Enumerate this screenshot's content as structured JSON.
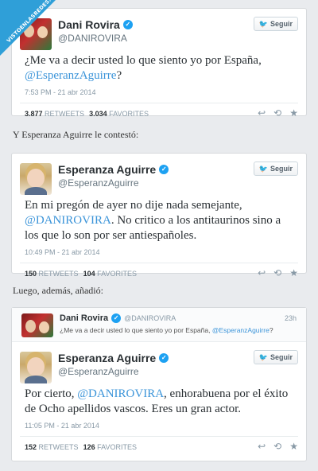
{
  "watermark": "VISTOENLASREDES.com",
  "tweet1": {
    "name": "Dani Rovira",
    "handle": "@DANIROVIRA",
    "follow": "Seguir",
    "text_a": "¿Me va a decir usted lo que siento yo por España,",
    "mention": "@EsperanzAguirre",
    "text_b": "?",
    "time": "7:53 PM - 21 abr 2014",
    "retweets": "3.877",
    "retweets_label": "RETWEETS",
    "favorites": "3.034",
    "favorites_label": "FAVORITES"
  },
  "caption1": "Y Esperanza Aguirre le contestó:",
  "tweet2": {
    "name": "Esperanza Aguirre",
    "handle": "@EsperanzAguirre",
    "follow": "Seguir",
    "text_a": "En mi pregón de ayer no dije nada semejante,",
    "mention": "@DANIROVIRA",
    "text_b": ". No critico a los antitaurinos sino a los que lo son por ser antiespañoles.",
    "time": "10:49 PM - 21 abr 2014",
    "retweets": "150",
    "retweets_label": "RETWEETS",
    "favorites": "104",
    "favorites_label": "FAVORITES"
  },
  "caption2": "Luego, además, añadió:",
  "quoted": {
    "name": "Dani Rovira",
    "handle": "@DANIROVIRA",
    "time": "23h",
    "text_a": "¿Me va a decir usted lo que siento yo por España,",
    "mention": "@EsperanzAguirre",
    "text_b": "?"
  },
  "tweet3": {
    "name": "Esperanza Aguirre",
    "handle": "@EsperanzAguirre",
    "follow": "Seguir",
    "text_a": "Por cierto,",
    "mention": "@DANIROVIRA",
    "text_b": ", enhorabuena por el éxito de Ocho apellidos vascos. Eres un gran actor.",
    "time": "11:05 PM - 21 abr 2014",
    "retweets": "152",
    "retweets_label": "RETWEETS",
    "favorites": "126",
    "favorites_label": "FAVORITES"
  },
  "icons": [
    "verified-icon",
    "twitter-bird-icon",
    "reply-icon",
    "retweet-icon",
    "favorite-icon"
  ],
  "colors": {
    "link": "#3b94d9",
    "accent": "#55acee",
    "muted": "#8899a6"
  }
}
